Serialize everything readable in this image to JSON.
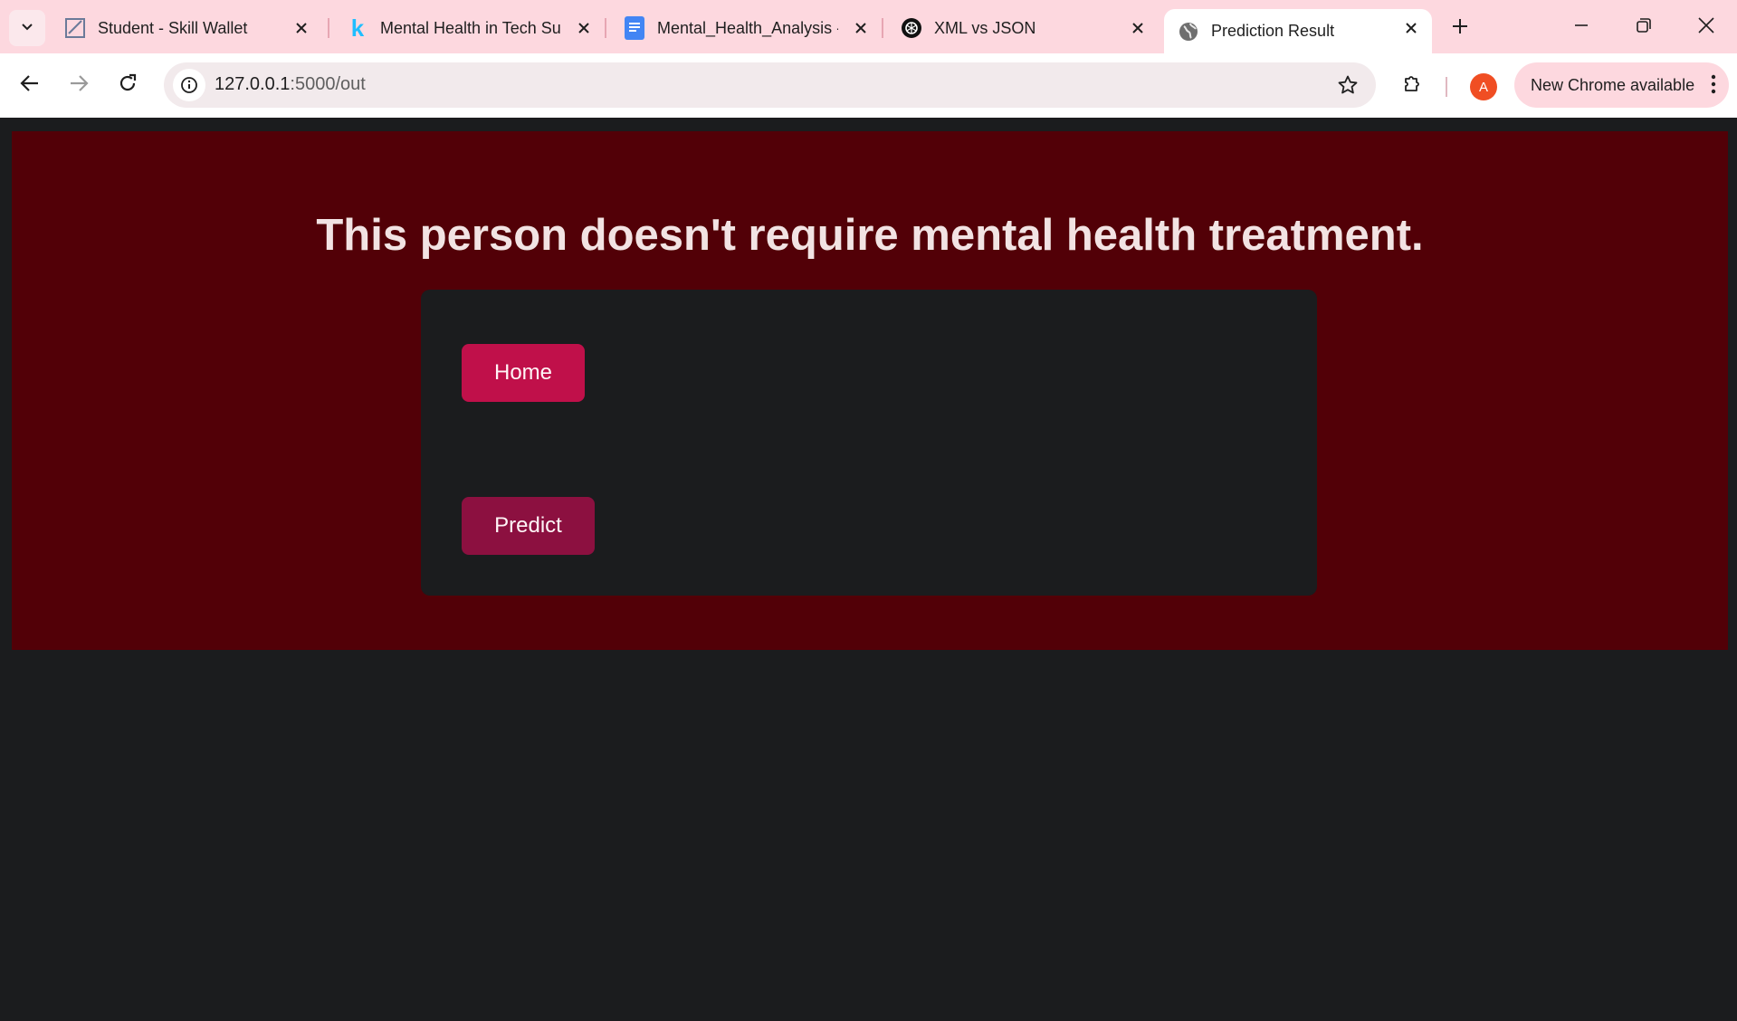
{
  "browser": {
    "tabs": [
      {
        "label": "Student - Skill Wallet",
        "icon": "skill-wallet-icon"
      },
      {
        "label": "Mental Health in Tech Su",
        "icon": "kaggle-icon"
      },
      {
        "label": "Mental_Health_Analysis -",
        "icon": "google-docs-icon"
      },
      {
        "label": "XML vs JSON",
        "icon": "chatgpt-icon"
      },
      {
        "label": "Prediction Result",
        "icon": "globe-icon",
        "active": true
      }
    ],
    "address": {
      "host": "127.0.0.1",
      "path": ":5000/out"
    },
    "profile_initial": "A",
    "update_label": "New Chrome available"
  },
  "page": {
    "headline": "This person doesn't require mental health treatment.",
    "home_button": "Home",
    "predict_button": "Predict"
  },
  "colors": {
    "hero_bg": "#520007",
    "card_bg": "#1b1c1e",
    "home_button": "#c0104a",
    "predict_button": "#8c1040",
    "tabstrip": "#fdd8df"
  }
}
